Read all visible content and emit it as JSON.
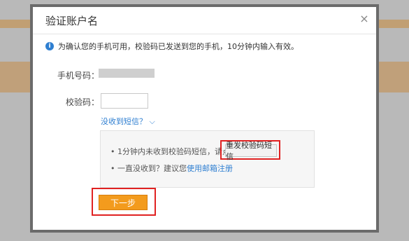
{
  "dialog": {
    "title": "验证账户名",
    "close_symbol": "×",
    "info_text": "为确认您的手机可用，校验码已发送到您的手机，10分钟内输入有效。",
    "phone_label": "手机号码：",
    "code_label": "校验码：",
    "code_value": "",
    "no_sms_link": "没收到短信？",
    "help_line_1": "1分钟内未收到校验码短信，请点击",
    "resend_button": "重发校验码短信",
    "help_line_2_prefix": "一直没收到？建议您",
    "help_line_2_link": "使用邮箱注册",
    "next_button": "下一步"
  },
  "colors": {
    "link": "#2f7fd1",
    "primary_button": "#f39b1d",
    "highlight": "#e02222"
  }
}
